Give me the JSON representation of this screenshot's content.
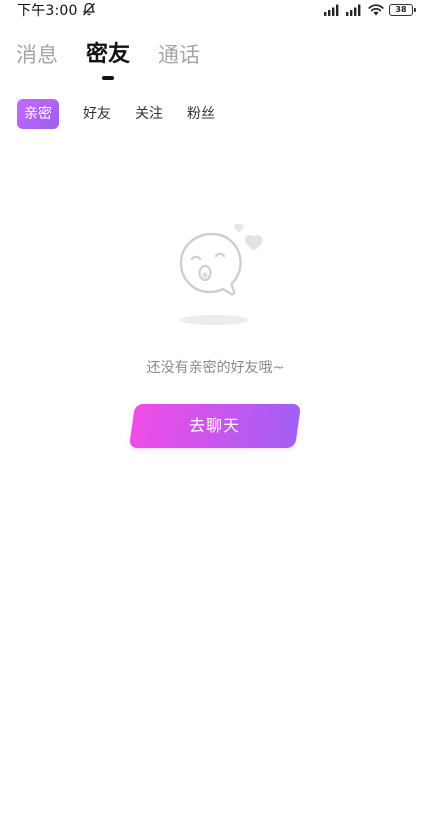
{
  "status_bar": {
    "time": "下午3:00",
    "battery_level": "38",
    "icons": [
      "silent-mode-icon",
      "signal-icon",
      "signal-icon",
      "wifi-icon",
      "battery-icon"
    ]
  },
  "main_tabs": [
    {
      "label": "消息",
      "active": false
    },
    {
      "label": "密友",
      "active": true
    },
    {
      "label": "通话",
      "active": false
    }
  ],
  "sub_tabs": [
    {
      "label": "亲密",
      "active": true
    },
    {
      "label": "好友",
      "active": false
    },
    {
      "label": "关注",
      "active": false
    },
    {
      "label": "粉丝",
      "active": false
    }
  ],
  "empty_state": {
    "illustration": "empty-ghost-icon",
    "message": "还没有亲密的好友哦~",
    "button_label": "去聊天"
  },
  "colors": {
    "accent_gradient_start": "#f04ce6",
    "accent_gradient_end": "#a260f4",
    "active_subtab": "#b366f7",
    "inactive_tab_text": "#a6a6a6"
  }
}
